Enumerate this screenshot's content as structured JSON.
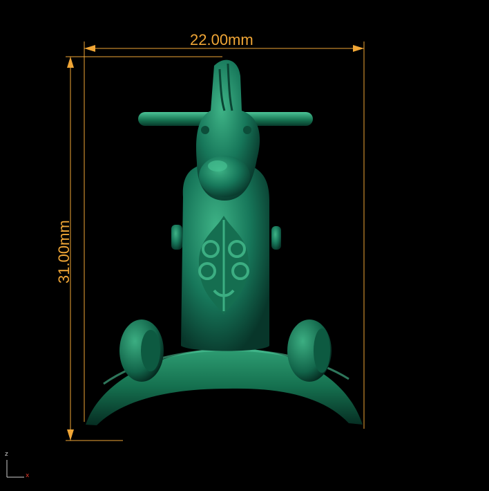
{
  "view": {
    "background": "#000000",
    "model_color": "#1b8a62",
    "dimension_color": "#f0a636"
  },
  "dimensions": {
    "width_label": "22.00mm",
    "height_label": "31.00mm"
  },
  "axis_gizmo": {
    "z_label": "z",
    "x_label": "x",
    "x_color": "#e23a2a"
  }
}
